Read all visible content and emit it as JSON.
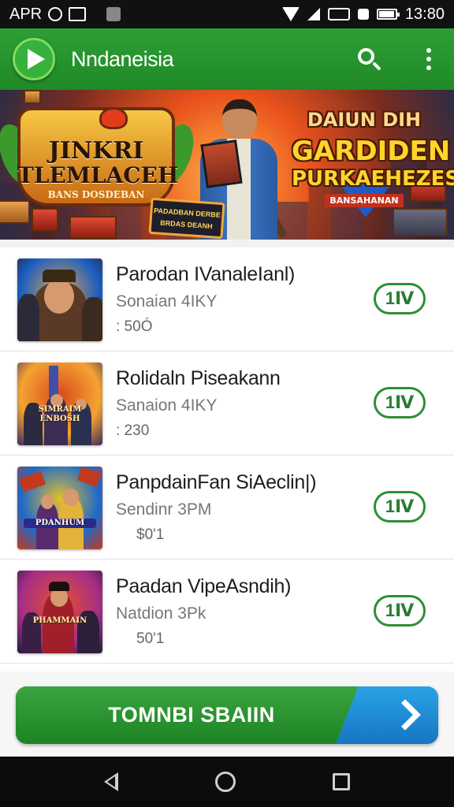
{
  "status_bar": {
    "left_text": "APR",
    "time": "13:80",
    "battery_level": 0.85,
    "icons": [
      "gallery-icon",
      "wifi-icon",
      "signal-icon",
      "sim-icon",
      "battery-icon"
    ]
  },
  "app_bar": {
    "title": "Nndaneisia",
    "icons": [
      "play-logo-icon",
      "search-icon",
      "more-vert-icon"
    ]
  },
  "banner": {
    "left_logo": {
      "line1": "JINKRI",
      "line2": "TLEMLACEH",
      "tagline": "BANS DOSDEBAN"
    },
    "sign": {
      "line1": "PADADBAN DERBE",
      "line2": "BRDAS DEANH"
    },
    "right_logo": {
      "line1": "DAIUN DIH",
      "line2": "GARDIDEN",
      "line3": "PURKAEHEZES",
      "tagline": "BANSAHANAN"
    }
  },
  "games": [
    {
      "title": "Parodan IVanaleIanl)",
      "subtitle": "Sonaian   4IKY",
      "meta": ":   50Ó",
      "price": "1Ⅳ",
      "thumb_palette": [
        "#1a5ec2",
        "#e3a34a",
        "#2a1c16"
      ],
      "thumb_tag": ""
    },
    {
      "title": "Rolidaln Piseakann",
      "subtitle": "Sanaion   4IKY",
      "meta": ":   230",
      "price": "1Ⅳ",
      "thumb_palette": [
        "#f5a331",
        "#d8491d",
        "#3a2a5c"
      ],
      "thumb_tag": "SIMRAIM ENBOSH"
    },
    {
      "title": "PanpdainFan SiAeclin|)",
      "subtitle": "Sendinr   3PM",
      "meta": "$0'1",
      "price": "1Ⅳ",
      "thumb_palette": [
        "#1d6ac9",
        "#e6c02c",
        "#c23a1e"
      ],
      "thumb_tag": "PDANHUM"
    },
    {
      "title": "Paadan VipeAsndih)",
      "subtitle": "Natdion   3Pk",
      "meta": "50'1",
      "price": "1Ⅳ",
      "thumb_palette": [
        "#a72e86",
        "#e5502a",
        "#1d1a3e"
      ],
      "thumb_tag": "PHAMMAIN"
    }
  ],
  "cta": {
    "label": "TOMNBI SBAIIN",
    "icon": "chevron-right-icon"
  },
  "nav": {
    "icons": [
      "back-icon",
      "home-icon",
      "recents-icon"
    ]
  }
}
